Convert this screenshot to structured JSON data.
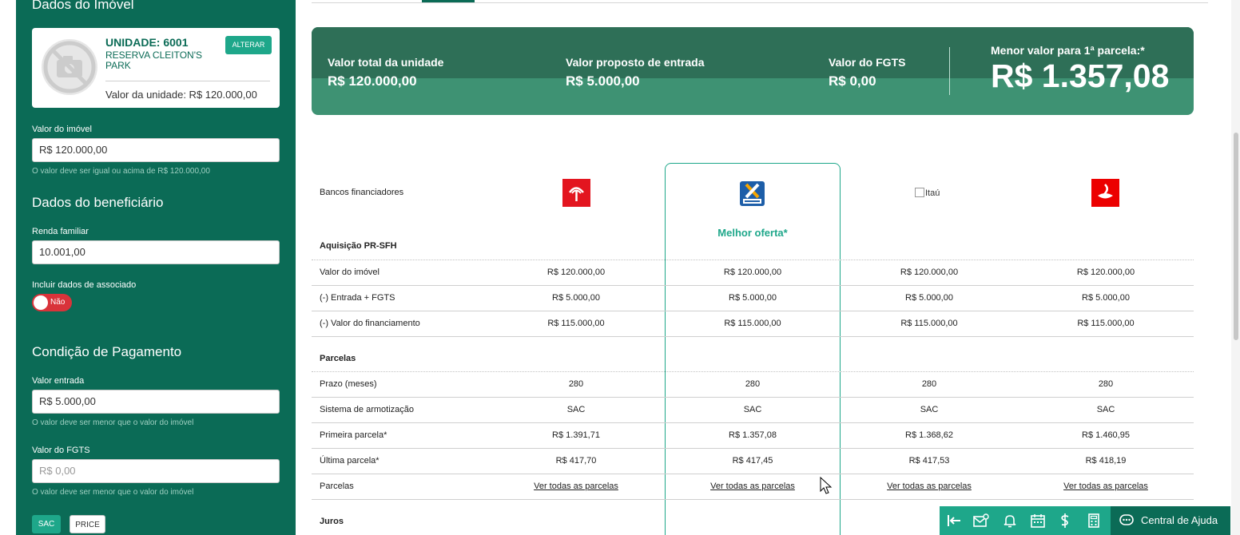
{
  "sidebar": {
    "property_section_title": "Dados do Imóvel",
    "unit": {
      "name": "UNIDADE: 6001",
      "project": "RESERVA CLEITON'S PARK",
      "alter_button": "ALTERAR",
      "value_text": "Valor da unidade: R$ 120.000,00"
    },
    "property_value": {
      "label": "Valor do imóvel",
      "value": "R$ 120.000,00",
      "hint": "O valor deve ser igual ou acima de R$ 120.000,00"
    },
    "beneficiary_title": "Dados do beneficiário",
    "family_income": {
      "label": "Renda familiar",
      "value": "10.001,00"
    },
    "associate": {
      "label": "Incluir dados de associado",
      "toggle_text": "Não"
    },
    "payment_title": "Condição de Pagamento",
    "down_payment": {
      "label": "Valor entrada",
      "value": "R$ 5.000,00",
      "hint": "O valor deve ser menor que o valor do imóvel"
    },
    "fgts": {
      "label": "Valor do FGTS",
      "placeholder": "R$ 0,00",
      "hint": "O valor deve ser menor que o valor do imóvel"
    },
    "payment_types": [
      "SAC",
      "PRICE"
    ]
  },
  "summary": {
    "total_label": "Valor total da unidade",
    "total_value": "R$ 120.000,00",
    "entry_label": "Valor proposto de entrada",
    "entry_value": "R$ 5.000,00",
    "fgts_label": "Valor do FGTS",
    "fgts_value": "R$ 0,00",
    "lowest_label": "Menor valor para 1ª parcela:*",
    "lowest_value": "R$ 1.357,08"
  },
  "comparison": {
    "banks_label": "Bancos financiadores",
    "itau_alt": "Itaú",
    "best_offer": "Melhor oferta*",
    "sections": {
      "acquisition": "Aquisição PR-SFH",
      "installments": "Parcelas",
      "interest": "Juros"
    },
    "rows": [
      {
        "label": "Valor do imóvel",
        "values": [
          "R$ 120.000,00",
          "R$ 120.000,00",
          "R$ 120.000,00",
          "R$ 120.000,00"
        ]
      },
      {
        "label": "(-) Entrada + FGTS",
        "values": [
          "R$ 5.000,00",
          "R$ 5.000,00",
          "R$ 5.000,00",
          "R$ 5.000,00"
        ]
      },
      {
        "label": "(-) Valor do financiamento",
        "values": [
          "R$ 115.000,00",
          "R$ 115.000,00",
          "R$ 115.000,00",
          "R$ 115.000,00"
        ]
      },
      {
        "label": "Prazo (meses)",
        "values": [
          "280",
          "280",
          "280",
          "280"
        ]
      },
      {
        "label": "Sistema de armotização",
        "values": [
          "SAC",
          "SAC",
          "SAC",
          "SAC"
        ]
      },
      {
        "label": "Primeira parcela*",
        "values": [
          "R$ 1.391,71",
          "R$ 1.357,08",
          "R$ 1.368,62",
          "R$ 1.460,95"
        ]
      },
      {
        "label": "Última parcela*",
        "values": [
          "R$ 417,70",
          "R$ 417,45",
          "R$ 417,53",
          "R$ 418,19"
        ]
      },
      {
        "label": "Parcelas",
        "values": [
          "Ver todas as parcelas",
          "Ver todas as parcelas",
          "Ver todas as parcelas",
          "Ver todas as parcelas"
        ]
      }
    ]
  },
  "footer": {
    "help_label": "Central de Ajuda"
  },
  "colors": {
    "sidebar_bg": "#0b6b56",
    "accent": "#1ea78a",
    "banner_dark": "#2e6f57",
    "banner_light": "#3e9273",
    "toggle_off": "#d9333a"
  }
}
